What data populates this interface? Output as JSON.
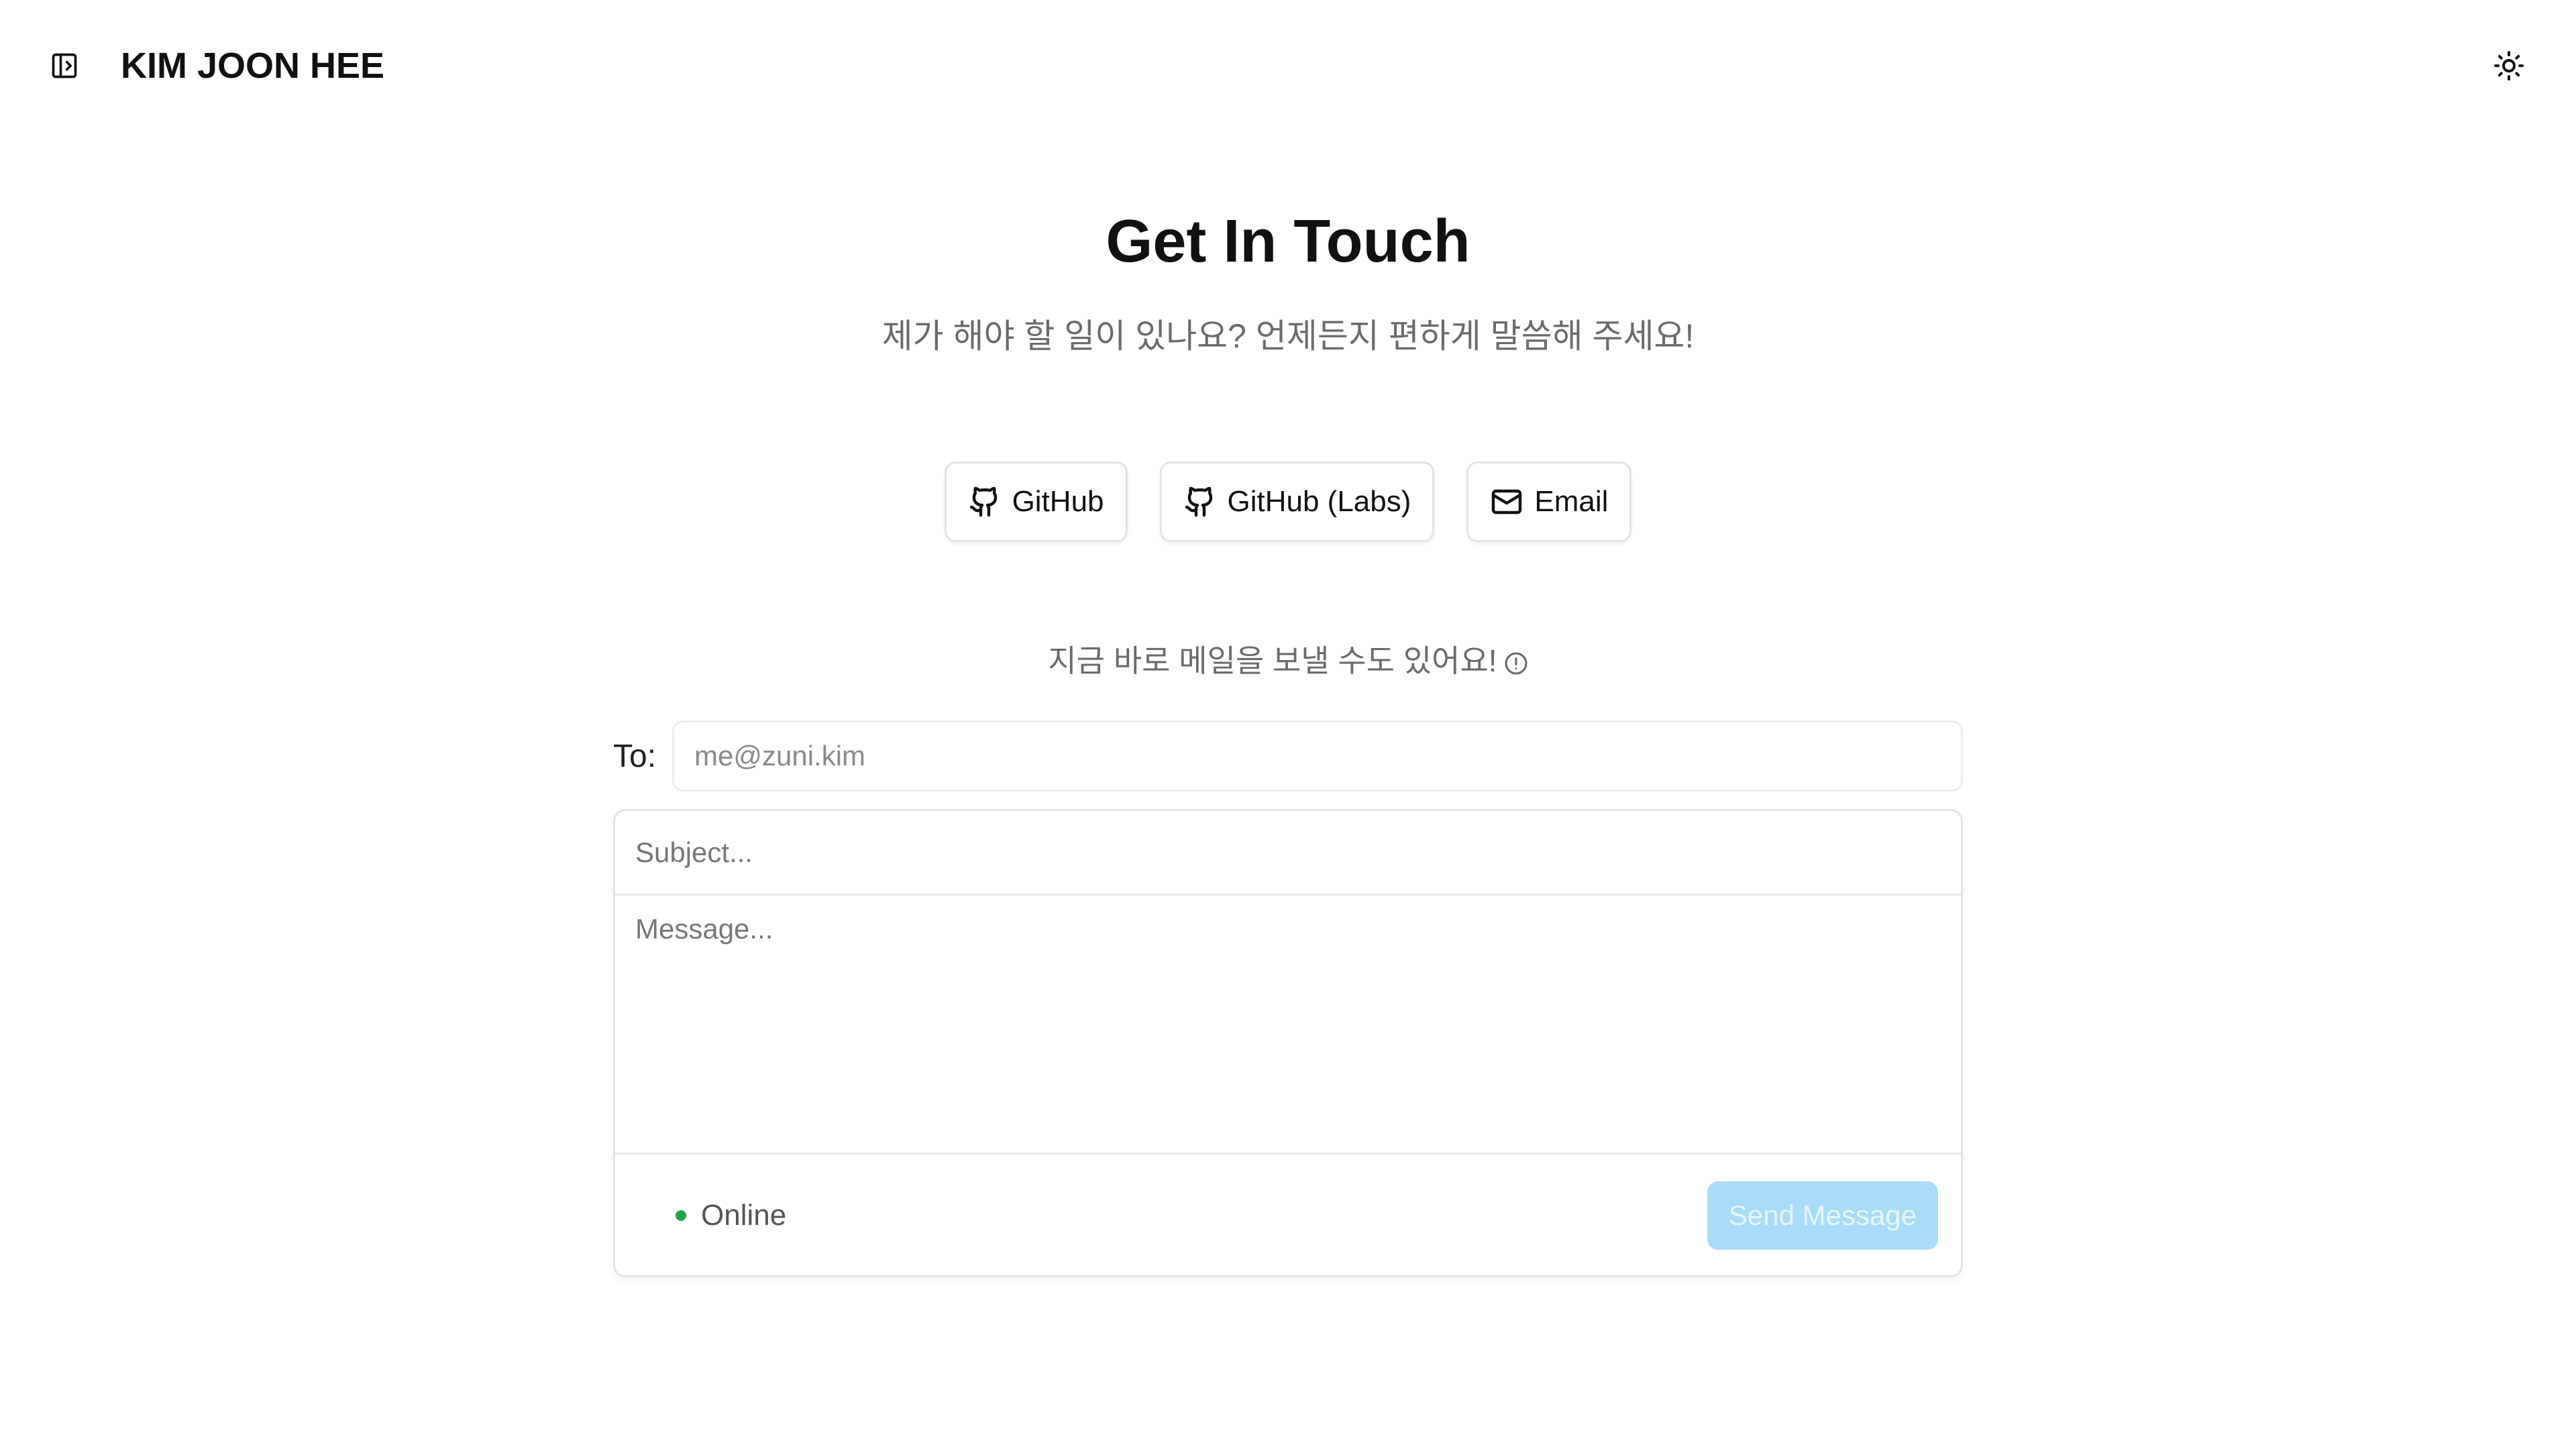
{
  "header": {
    "title": "KIM JOON HEE",
    "sidebar_icon": "sidebar-toggle-icon",
    "theme_icon": "sun-icon"
  },
  "hero": {
    "title": "Get In Touch",
    "subtitle": "제가 해야 할 일이 있나요? 언제든지 편하게 말씀해 주세요!"
  },
  "links": [
    {
      "label": "GitHub",
      "icon": "github-icon"
    },
    {
      "label": "GitHub (Labs)",
      "icon": "github-icon"
    },
    {
      "label": "Email",
      "icon": "mail-icon"
    }
  ],
  "note": {
    "text": "지금 바로 메일을 보낼 수도 있어요!",
    "icon": "info-icon"
  },
  "form": {
    "to_label": "To:",
    "to_placeholder": "me@zuni.kim",
    "subject_placeholder": "Subject...",
    "message_placeholder": "Message...",
    "status": "Online",
    "send_label": "Send Message"
  },
  "colors": {
    "status_online": "#22a447",
    "send_button_bg": "#a9dcf8"
  }
}
